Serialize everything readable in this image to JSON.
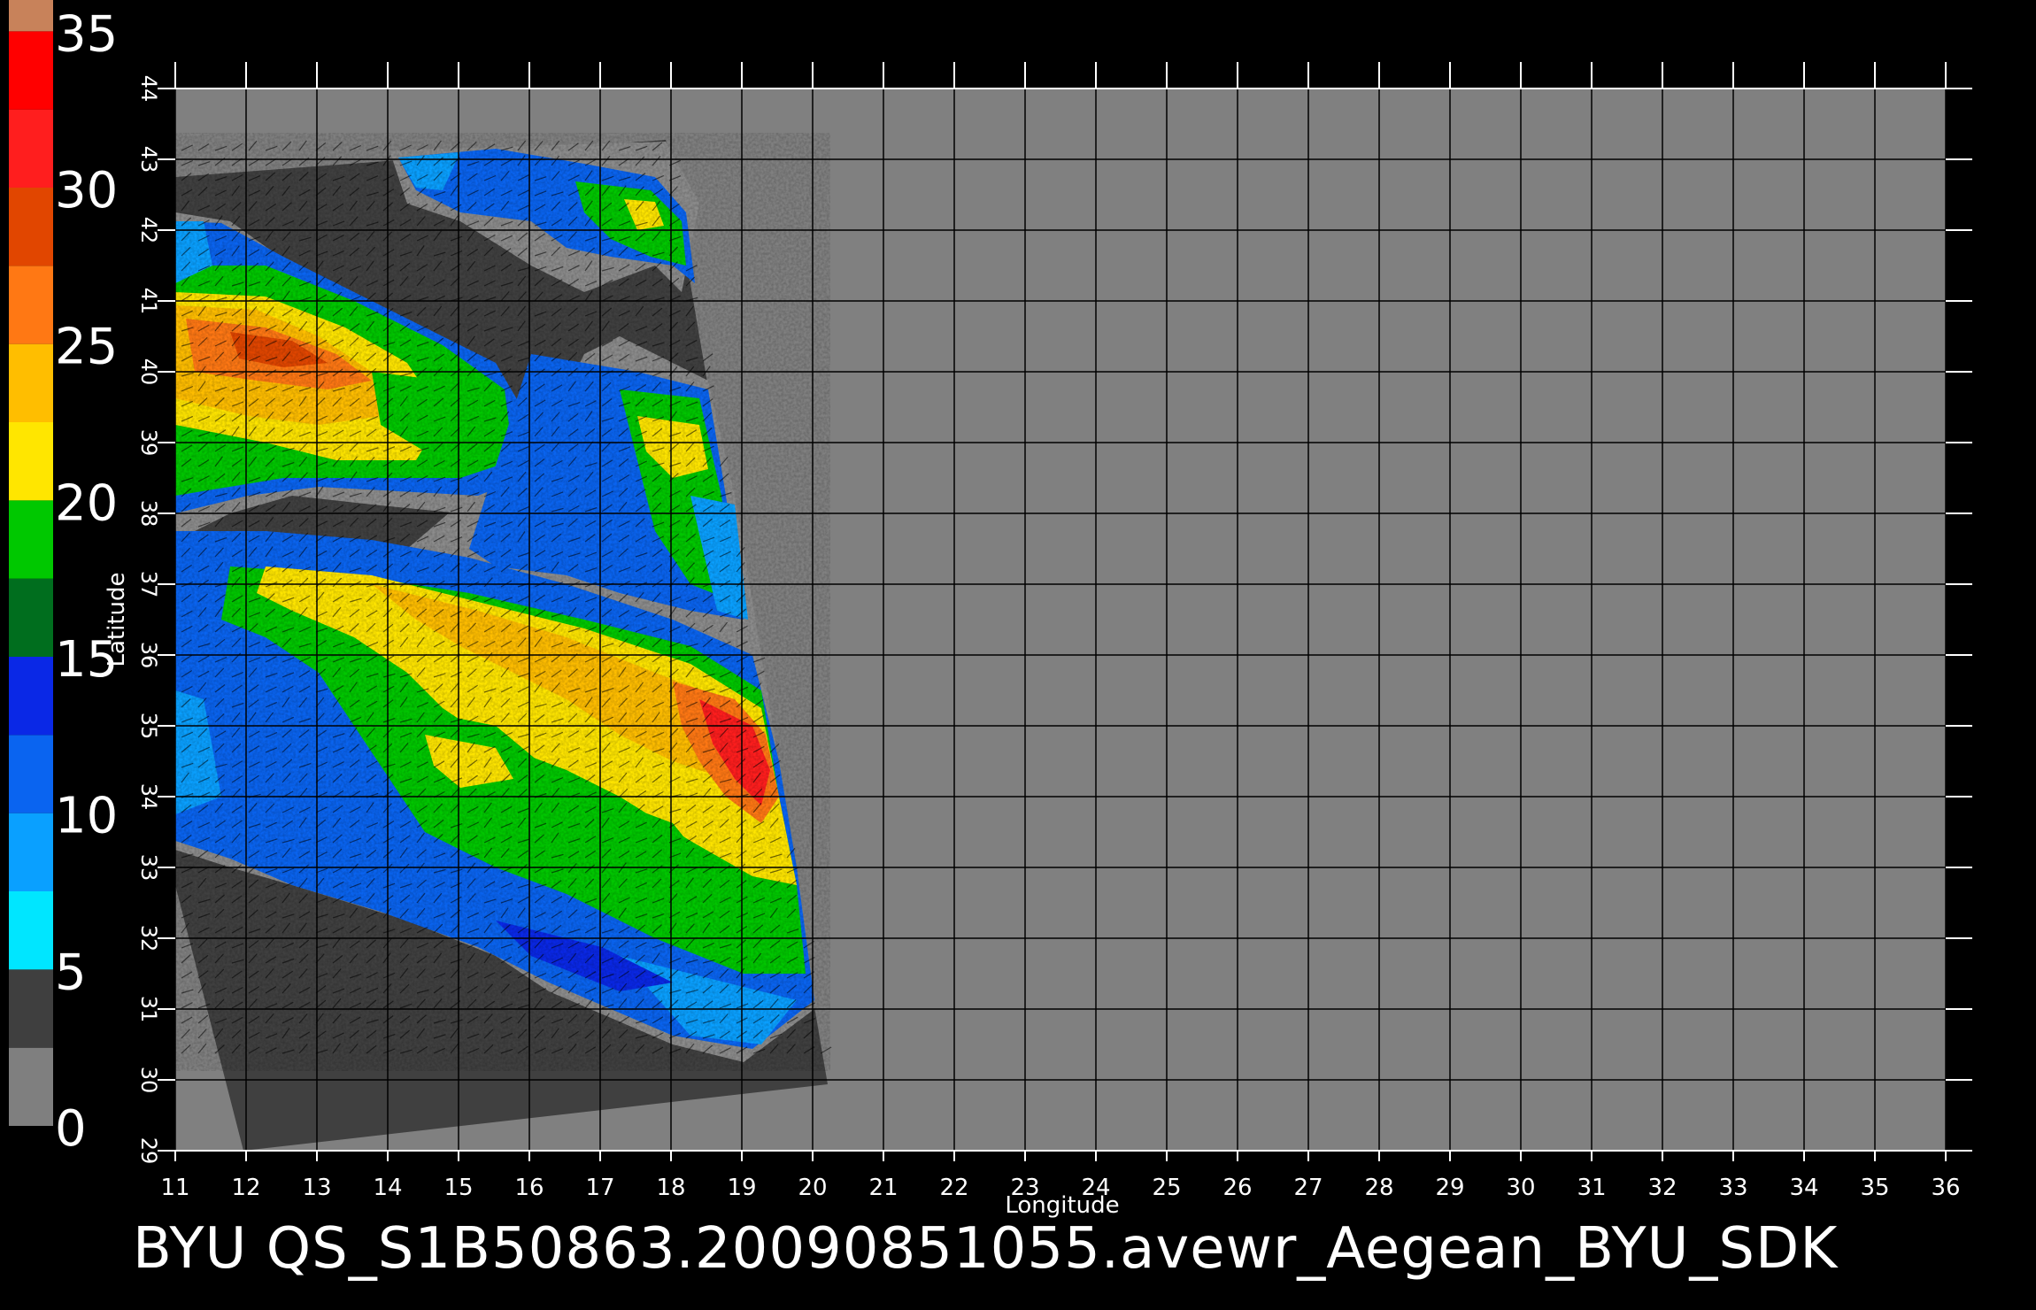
{
  "colorbar": {
    "ticks": [
      "0",
      "5",
      "10",
      "15",
      "20",
      "25",
      "30",
      "35"
    ],
    "bands": [
      {
        "range": [
          0,
          2.5
        ],
        "color": "#7f7f7f"
      },
      {
        "range": [
          2.5,
          5
        ],
        "color": "#3f3f3f"
      },
      {
        "range": [
          5,
          7.5
        ],
        "color": "#00e6ff"
      },
      {
        "range": [
          7.5,
          10
        ],
        "color": "#0aa0ff"
      },
      {
        "range": [
          10,
          12.5
        ],
        "color": "#0a64f0"
      },
      {
        "range": [
          12.5,
          15
        ],
        "color": "#0a28e6"
      },
      {
        "range": [
          15,
          17.5
        ],
        "color": "#006e1e"
      },
      {
        "range": [
          17.5,
          20
        ],
        "color": "#00c800"
      },
      {
        "range": [
          20,
          22.5
        ],
        "color": "#ffe600"
      },
      {
        "range": [
          22.5,
          25
        ],
        "color": "#ffbe00"
      },
      {
        "range": [
          25,
          27.5
        ],
        "color": "#ff7814"
      },
      {
        "range": [
          27.5,
          30
        ],
        "color": "#e14600"
      },
      {
        "range": [
          30,
          32.5
        ],
        "color": "#ff1e1e"
      },
      {
        "range": [
          32.5,
          35
        ],
        "color": "#ff0000"
      },
      {
        "range": [
          35,
          36
        ],
        "color": "#c8825a"
      }
    ]
  },
  "map": {
    "lon_range": [
      11,
      36
    ],
    "lat_range": [
      29,
      44
    ],
    "lon_ticks": [
      "11",
      "12",
      "13",
      "14",
      "15",
      "16",
      "17",
      "18",
      "19",
      "20",
      "21",
      "22",
      "23",
      "24",
      "25",
      "26",
      "27",
      "28",
      "29",
      "30",
      "31",
      "32",
      "33",
      "34",
      "35",
      "36"
    ],
    "lat_ticks": [
      "29",
      "30",
      "31",
      "32",
      "33",
      "34",
      "35",
      "36",
      "37",
      "38",
      "39",
      "40",
      "41",
      "42",
      "43",
      "44"
    ],
    "xlabel": "Longitude",
    "ylabel": "Latitude",
    "background_color": "#808080",
    "swath_color": "#404040",
    "grid": true,
    "grid_color": "#000000"
  },
  "footer": {
    "title": "BYU  QS_S1B50863.20090851055.avewr_Aegean_BYU_SDK"
  }
}
